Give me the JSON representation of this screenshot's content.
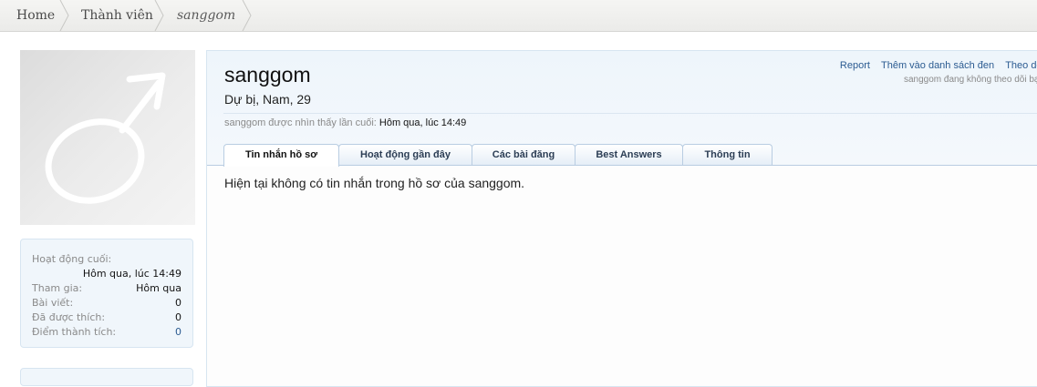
{
  "breadcrumb": {
    "items": [
      {
        "label": "Home"
      },
      {
        "label": "Thành viên"
      },
      {
        "label": "sanggom"
      }
    ]
  },
  "sidebar": {
    "avatar_icon": "male-symbol-icon",
    "stats": [
      {
        "label": "Hoạt động cuối:",
        "value": "Hôm qua, lúc 14:49"
      },
      {
        "label": "Tham gia:",
        "value": "Hôm qua"
      },
      {
        "label": "Bài viết:",
        "value": "0"
      },
      {
        "label": "Đã được thích:",
        "value": "0"
      },
      {
        "label": "Điểm thành tích:",
        "value": "0"
      }
    ]
  },
  "profile": {
    "username": "sanggom",
    "title": "Dự bị, Nam, 29",
    "last_seen_label": "sanggom được nhìn thấy lần cuối:",
    "last_seen_value": "Hôm qua, lúc 14:49"
  },
  "actions": {
    "report": "Report",
    "ignore": "Thêm vào danh sách đen",
    "follow": "Theo dõi",
    "follow_note": "sanggom đang không theo dõi bạn"
  },
  "tabs": [
    {
      "label": "Tin nhắn hồ sơ",
      "active": true
    },
    {
      "label": "Hoạt động gần đây",
      "active": false
    },
    {
      "label": "Các bài đăng",
      "active": false
    },
    {
      "label": "Best Answers",
      "active": false
    },
    {
      "label": "Thông tin",
      "active": false
    }
  ],
  "content": {
    "empty_message": "Hiện tại không có tin nhắn trong hồ sơ của sanggom."
  },
  "colors": {
    "link": "#2b5b91",
    "panel_bg": "#f0f6fb",
    "panel_border": "#d7e5f1"
  }
}
